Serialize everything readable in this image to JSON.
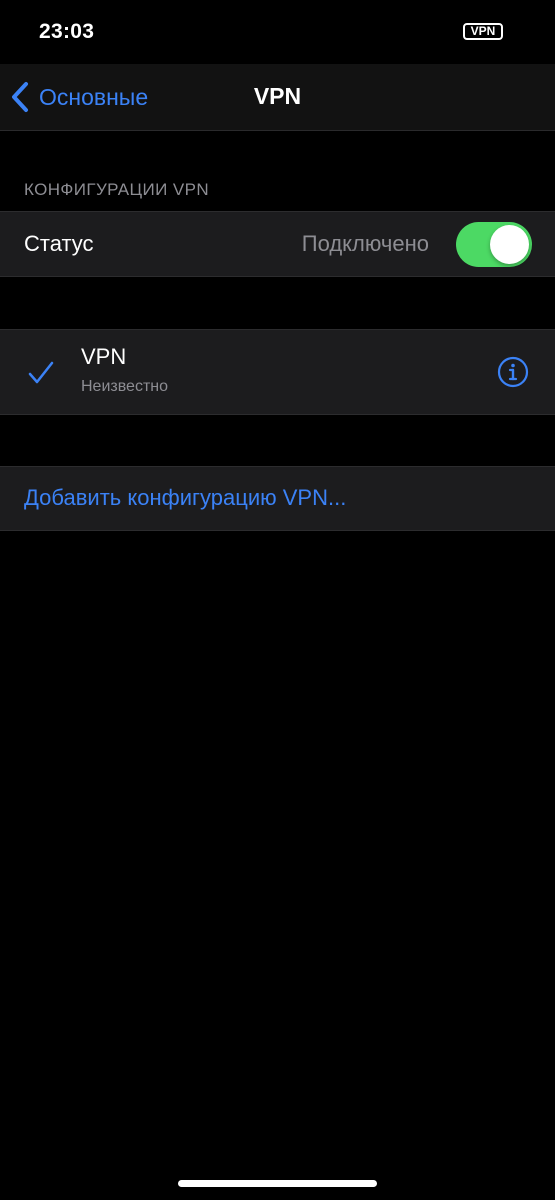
{
  "status_bar": {
    "time": "23:03",
    "vpn_badge": "VPN"
  },
  "nav": {
    "back_label": "Основные",
    "back_icon": "chevron-left-icon",
    "title": "VPN"
  },
  "section": {
    "header": "КОНФИГУРАЦИИ VPN"
  },
  "status_row": {
    "label": "Статус",
    "value": "Подключено",
    "toggle_on": true
  },
  "vpn_config": {
    "name": "VPN",
    "subtitle": "Неизвестно",
    "selected": true,
    "check_icon": "checkmark-icon",
    "info_icon": "info-icon"
  },
  "add_config": {
    "label": "Добавить конфигурацию VPN..."
  },
  "colors": {
    "accent": "#3b82f6",
    "toggle_on": "#4cd964",
    "background": "#000000",
    "cell": "#1c1c1e",
    "secondary_text": "#8d8d93"
  }
}
